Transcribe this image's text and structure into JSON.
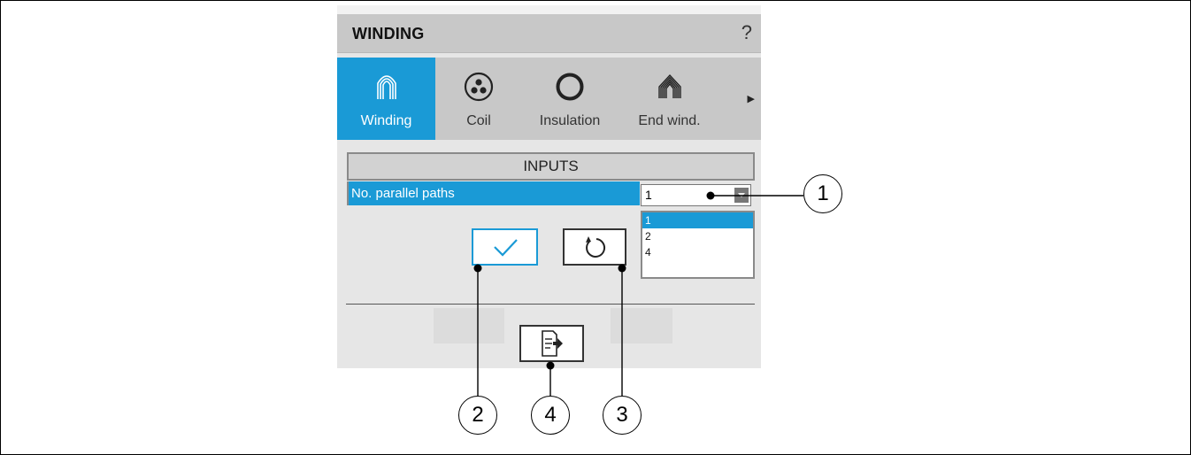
{
  "panel": {
    "title": "WINDING",
    "help_label": "?"
  },
  "tabs": [
    {
      "label": "Winding",
      "icon": "winding-icon",
      "active": true
    },
    {
      "label": "Coil",
      "icon": "coil-icon",
      "active": false
    },
    {
      "label": "Insulation",
      "icon": "insulation-icon",
      "active": false
    },
    {
      "label": "End wind.",
      "icon": "end-winding-icon",
      "active": false
    }
  ],
  "inputs": {
    "header": "INPUTS",
    "param_label": "No. parallel paths",
    "selected_value": "1",
    "options": [
      "1",
      "2",
      "4"
    ]
  },
  "buttons": {
    "apply": "check-icon",
    "reset": "reset-icon",
    "export": "export-icon"
  },
  "callouts": [
    "1",
    "2",
    "4",
    "3"
  ],
  "colors": {
    "accent": "#1a9ad6",
    "panel_bg": "#e6e6e6",
    "tab_bg": "#c8c8c8"
  }
}
